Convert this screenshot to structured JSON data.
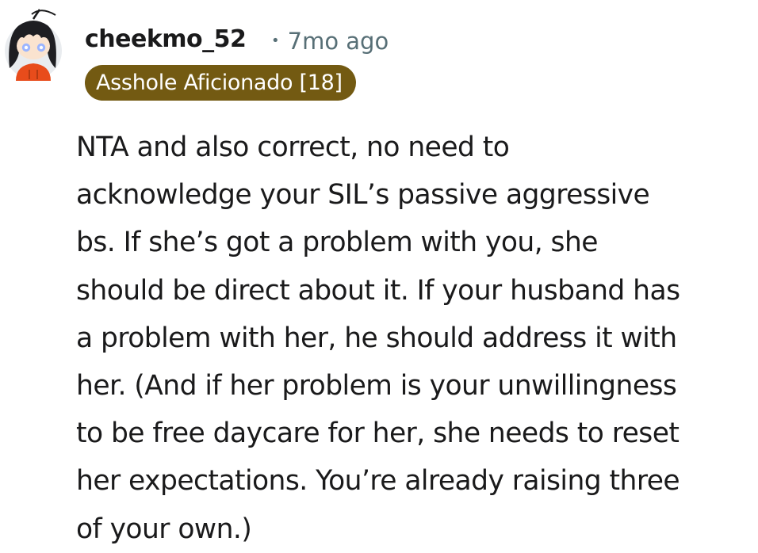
{
  "comment": {
    "author": "cheekmo_52",
    "separator": "•",
    "timestamp": "7mo ago",
    "flair": "Asshole Aficionado [18]",
    "body_lines": [
      "NTA and also correct, no need to",
      "acknowledge your SIL’s passive aggressive",
      "bs. If she’s got a problem with you, she",
      "should be direct about it. If your husband has",
      "a problem with her, he should address it with",
      "her. (And if her problem is your unwillingness",
      "to be free daycare for her, she needs to reset",
      "her expectations. You’re already raising three",
      "of your own.)"
    ]
  },
  "colors": {
    "flair_background": "#735a12",
    "flair_text": "#ffffff",
    "meta_text": "#576f76",
    "body_text": "#1a1a1b"
  },
  "icons": {
    "avatar": "snoo-avatar-dark-hair-orange-hoodie"
  }
}
